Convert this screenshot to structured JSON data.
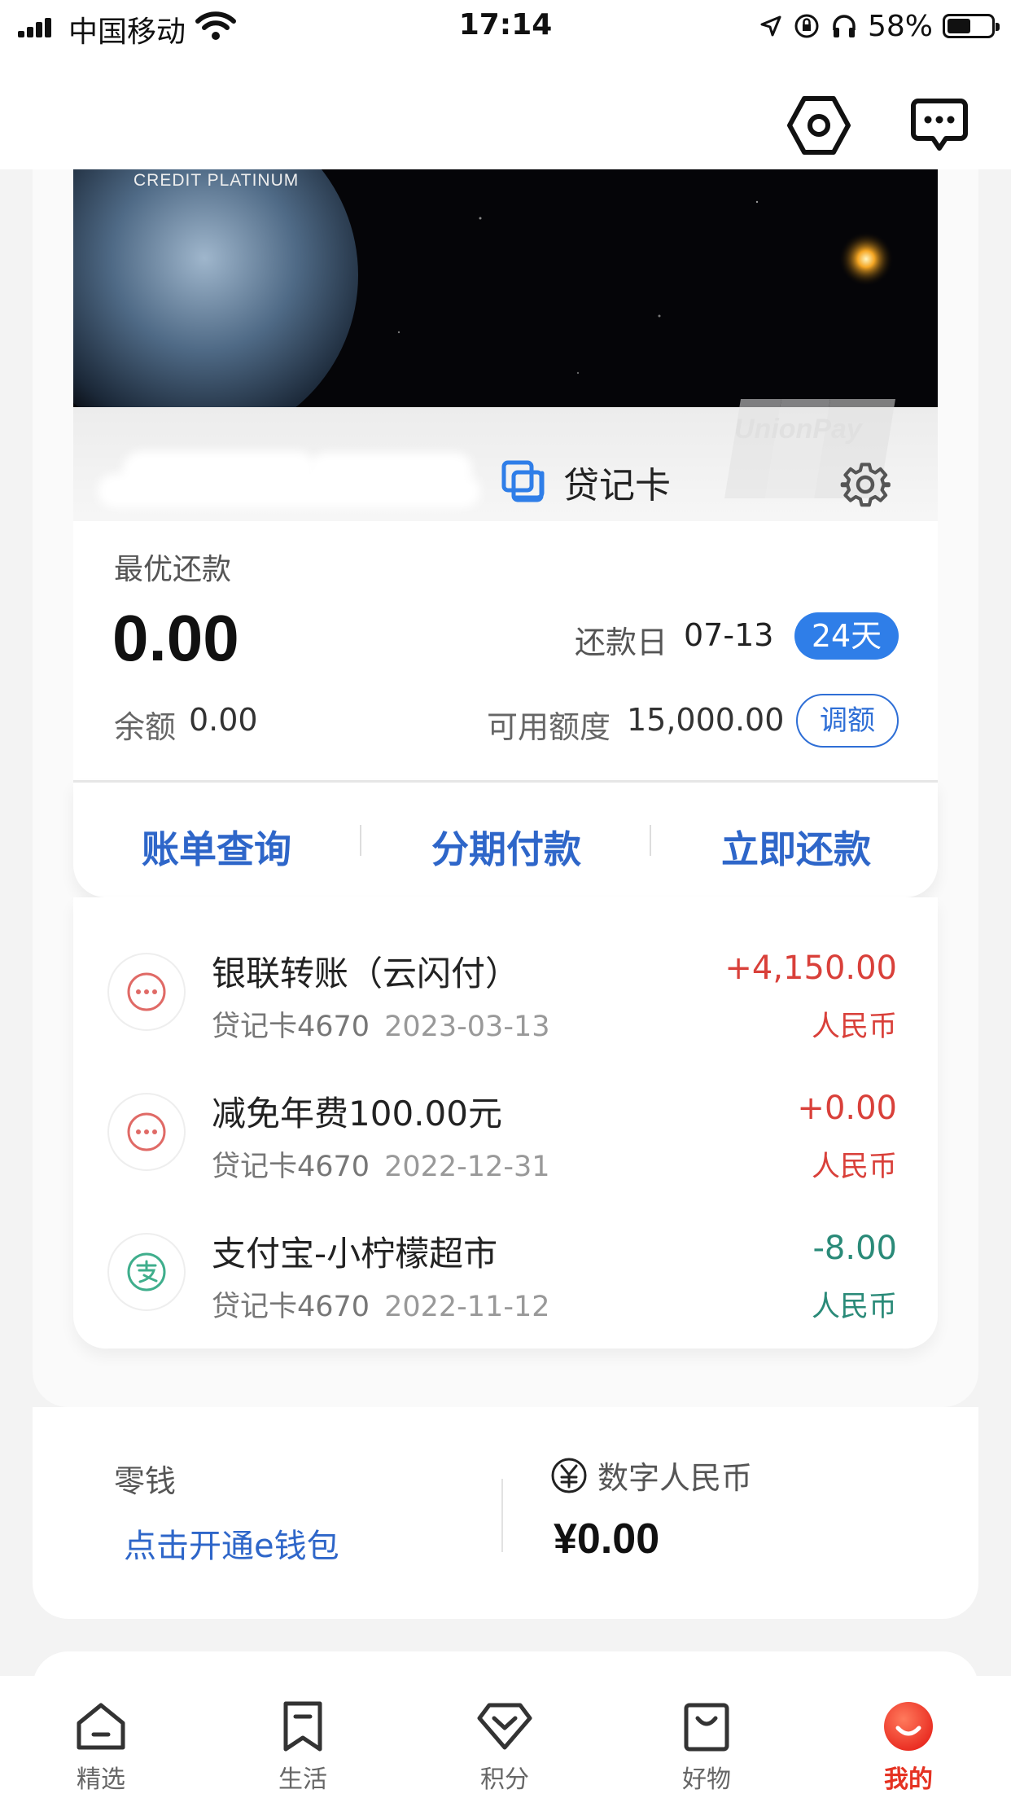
{
  "status_bar": {
    "carrier": "中国移动",
    "time": "17:14",
    "battery": "58%"
  },
  "top_nav": {
    "icons": [
      "scan-hexagon-icon",
      "message-icon"
    ]
  },
  "card": {
    "card_label": "CREDIT PLATINUM",
    "network_logo_text": "UnionPay",
    "type_label": "贷记卡",
    "settings_label": "设置"
  },
  "summary": {
    "optimal_repayment_label": "最优还款",
    "optimal_repayment_amount": "0.00",
    "due_label": "还款日",
    "due_date": "07-13",
    "days_badge": "24天",
    "balance_label": "余额",
    "balance_value": "0.00",
    "available_label": "可用额度",
    "available_value": "15,000.00",
    "adjust_label": "调额"
  },
  "actions": [
    {
      "label": "账单查询"
    },
    {
      "label": "分期付款"
    },
    {
      "label": "立即还款"
    }
  ],
  "transactions": [
    {
      "title": "银联转账（云闪付）",
      "card": "贷记卡4670",
      "date": "2023-03-13",
      "amount": "+4,150.00",
      "currency": "人民币",
      "icon": "more-dots-icon",
      "color": "#d9403a"
    },
    {
      "title": "减免年费100.00元",
      "card": "贷记卡4670",
      "date": "2022-12-31",
      "amount": "+0.00",
      "currency": "人民币",
      "icon": "more-dots-icon",
      "color": "#d9403a"
    },
    {
      "title": "支付宝-小柠檬超市",
      "card": "贷记卡4670",
      "date": "2022-11-12",
      "amount": "-8.00",
      "currency": "人民币",
      "icon": "alipay-icon",
      "color": "#2a8a78"
    }
  ],
  "wallet": {
    "change_label": "零钱",
    "open_wallet_label": "点击开通e钱包",
    "dcep_label": "数字人民币",
    "dcep_amount": "¥0.00"
  },
  "tab_bar": [
    {
      "label": "精选",
      "icon": "home-icon",
      "active": false
    },
    {
      "label": "生活",
      "icon": "bookmark-icon",
      "active": false
    },
    {
      "label": "积分",
      "icon": "diamond-icon",
      "active": false
    },
    {
      "label": "好物",
      "icon": "shopping-bag-icon",
      "active": false
    },
    {
      "label": "我的",
      "icon": "profile-smile-icon",
      "active": true
    }
  ],
  "colors": {
    "accent_blue": "#2e66c9",
    "badge_blue": "#2f7ee8",
    "credit_red": "#d9403a",
    "debit_green": "#2a8a78",
    "active_tab_red": "#e53222"
  }
}
